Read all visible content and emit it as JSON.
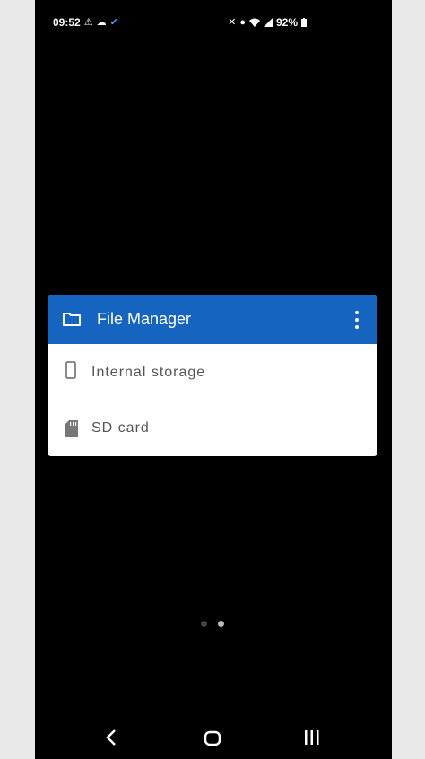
{
  "status_bar": {
    "time": "09:52",
    "battery": "92%"
  },
  "widget": {
    "title": "File Manager",
    "items": [
      {
        "label": "Internal storage",
        "icon": "phone-icon"
      },
      {
        "label": "SD card",
        "icon": "sd-card-icon"
      }
    ]
  },
  "pager": {
    "total": 2,
    "active_index": 1
  },
  "colors": {
    "header": "#1565c0",
    "background": "#000000",
    "card": "#ffffff"
  }
}
